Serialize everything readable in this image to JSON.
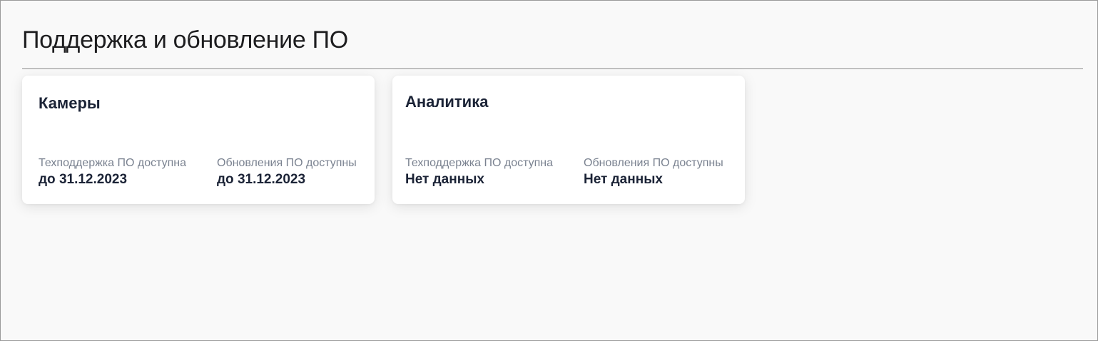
{
  "page": {
    "title": "Поддержка и обновление ПО"
  },
  "cards": [
    {
      "title": "Камеры",
      "support_label": "Техподдержка ПО доступна",
      "support_value": "до 31.12.2023",
      "updates_label": "Обновления ПО доступны",
      "updates_value": "до 31.12.2023"
    },
    {
      "title": "Аналитика",
      "support_label": "Техподдержка ПО доступна",
      "support_value": "Нет данных",
      "updates_label": "Обновления ПО доступны",
      "updates_value": "Нет данных"
    }
  ],
  "colors": {
    "background": "#f9f9f9",
    "card": "#ffffff",
    "title_text": "#1b2336",
    "label_text": "#7a8290",
    "divider": "#8c8c8c"
  }
}
